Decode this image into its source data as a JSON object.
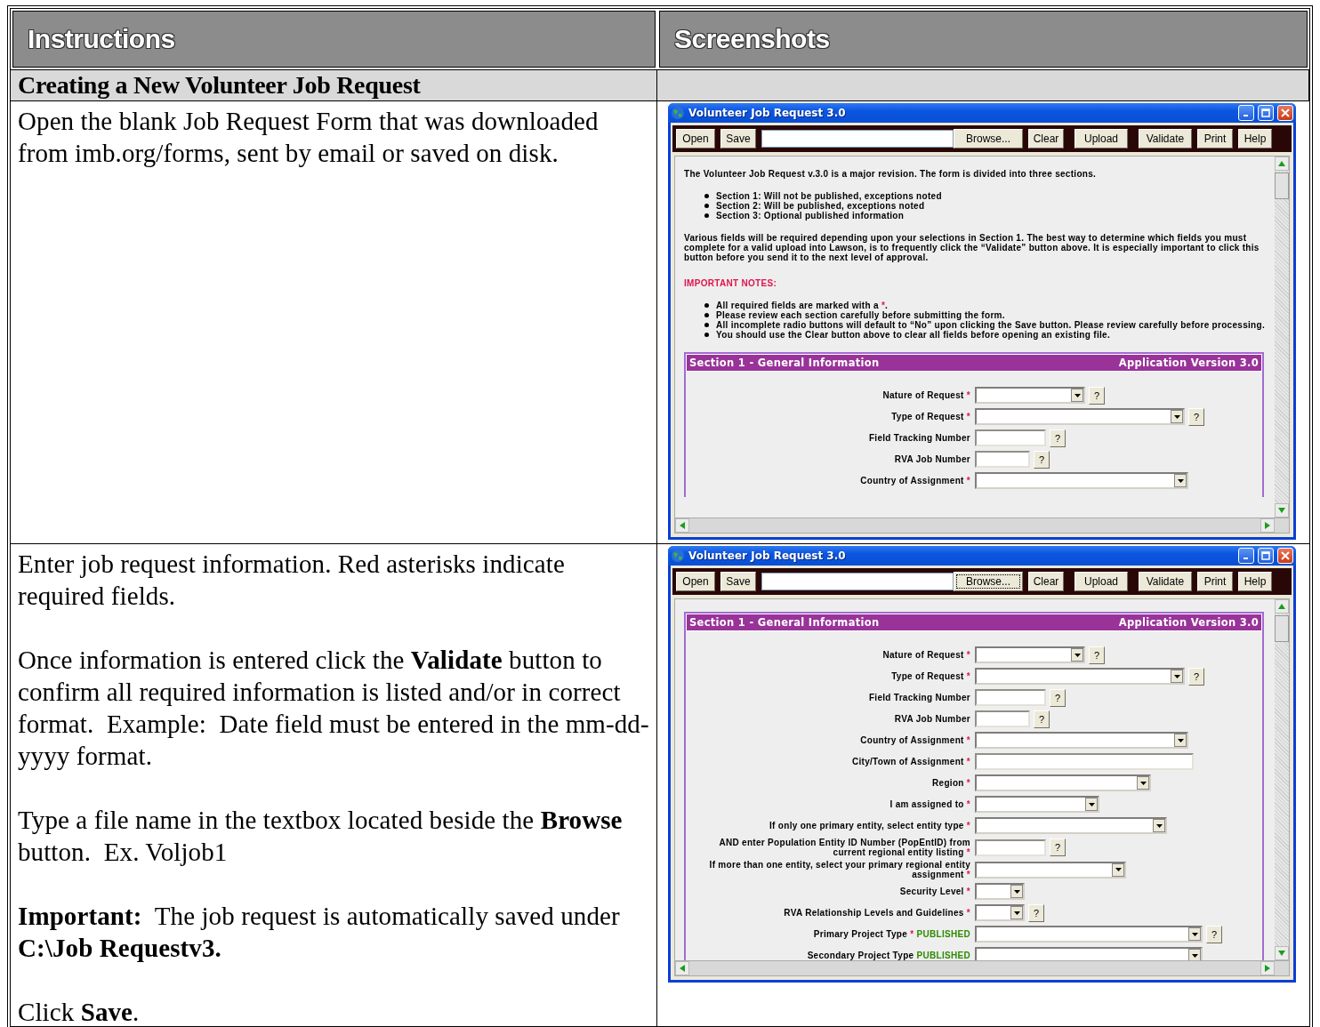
{
  "columns": [
    "Instructions",
    "Screenshots"
  ],
  "heading": "Creating a New Volunteer Job Request",
  "rows": [
    {
      "instructions": [
        "Open the blank Job Request Form that was downloaded from imb.org/forms, sent by email or saved on disk."
      ],
      "window": {
        "title": "Volunteer Job Request 3.0",
        "toolbar": [
          {
            "kind": "button",
            "label": "Open",
            "focused": false
          },
          {
            "kind": "button",
            "label": "Save",
            "focused": false
          },
          {
            "kind": "field"
          },
          {
            "kind": "button",
            "label": "Browse...",
            "focused": false
          },
          {
            "kind": "button",
            "label": "Clear",
            "focused": false
          },
          {
            "kind": "button",
            "label": "Upload",
            "focused": false
          },
          {
            "kind": "button",
            "label": "Validate",
            "focused": false
          },
          {
            "kind": "button",
            "label": "Print",
            "focused": false
          },
          {
            "kind": "button",
            "label": "Help",
            "focused": false
          }
        ],
        "intro": {
          "lead": "The Volunteer Job Request v.3.0 is a major revision. The form is divided into three sections.",
          "sections": [
            "Section 1: Will not be published, exceptions noted",
            "Section 2: Will be published, exceptions noted",
            "Section 3: Optional published information"
          ],
          "paragraph": "Various fields will be required depending upon your selections in Section 1. The best way to determine which fields you must complete for a valid upload into Lawson, is to frequently click the “Validate” button above. It is especially important to click this button before you send it to the next level of approval.",
          "notes_title": "IMPORTANT NOTES:",
          "notes": [
            {
              "text": "All required fields are marked with a ",
              "mark": "*",
              "tail": "."
            },
            {
              "text": "Please review each section carefully before submitting the form."
            },
            {
              "text": "All incomplete radio buttons will default to “No” upon clicking the Save button. Please review carefully before processing."
            },
            {
              "text": "You should use the Clear button above to clear all fields before opening an existing file."
            }
          ]
        },
        "section": {
          "title": "Section 1 - General Information",
          "version": "Application Version 3.0",
          "fields": [
            {
              "label": "Nature of Request",
              "required": "*",
              "kind": "select",
              "help": "?"
            },
            {
              "label": "Type of Request",
              "required": "*",
              "kind": "select",
              "help": "?"
            },
            {
              "label": "Field Tracking Number",
              "kind": "text",
              "help": "?"
            },
            {
              "label": "RVA Job Number",
              "kind": "text",
              "help": "?"
            },
            {
              "label": "Country of Assignment",
              "required": "*",
              "kind": "select"
            }
          ]
        }
      }
    },
    {
      "instructions": [
        "Enter job request information. Red asterisks indicate required fields.",
        "Once information is entered click the **Validate** button to confirm all required information is listed and/or in correct format.  Example:  Date field must be entered in the mm-dd-yyyy format.",
        "Type a file name in the textbox located beside the **Browse** button.  Ex. Voljob1",
        "**Important:**  The job request is automatically saved under **C:\\Job Requestv3.**",
        "Click **Save**."
      ],
      "window": {
        "title": "Volunteer Job Request 3.0",
        "toolbar": [
          {
            "kind": "button",
            "label": "Open",
            "focused": false
          },
          {
            "kind": "button",
            "label": "Save",
            "focused": false
          },
          {
            "kind": "field"
          },
          {
            "kind": "button",
            "label": "Browse...",
            "focused": true
          },
          {
            "kind": "button",
            "label": "Clear",
            "focused": false
          },
          {
            "kind": "button",
            "label": "Upload",
            "focused": false
          },
          {
            "kind": "button",
            "label": "Validate",
            "focused": false
          },
          {
            "kind": "button",
            "label": "Print",
            "focused": false
          },
          {
            "kind": "button",
            "label": "Help",
            "focused": false
          }
        ],
        "section": {
          "title": "Section 1 - General Information",
          "version": "Application Version 3.0",
          "fields": [
            {
              "label": "Nature of Request",
              "required": "*",
              "kind": "select",
              "help": "?"
            },
            {
              "label": "Type of Request",
              "required": "*",
              "kind": "select",
              "help": "?"
            },
            {
              "label": "Field Tracking Number",
              "kind": "text",
              "help": "?"
            },
            {
              "label": "RVA Job Number",
              "kind": "text",
              "help": "?"
            },
            {
              "label": "Country of Assignment",
              "required": "*",
              "kind": "select"
            },
            {
              "label": "City/Town of Assignment",
              "required": "*",
              "kind": "text"
            },
            {
              "label": "Region",
              "required": "*",
              "kind": "select"
            },
            {
              "label": "I am assigned to",
              "required": "*",
              "kind": "select"
            },
            {
              "label": "If only one primary entity, select entity type",
              "required": "*",
              "kind": "select"
            },
            {
              "label": "AND enter Population Entity ID Number (PopEntID) from current regional entity listing",
              "required": "*",
              "kind": "text",
              "help": "?"
            },
            {
              "label": "If more than one entity, select your primary regional entity assignment",
              "required": "*",
              "kind": "select"
            },
            {
              "label": "Security Level",
              "required": "*",
              "kind": "select"
            },
            {
              "label": "RVA Relationship Levels and Guidelines",
              "required": "*",
              "kind": "select",
              "help": "?"
            },
            {
              "label": "Primary Project Type",
              "required": "*",
              "published": "PUBLISHED",
              "kind": "select",
              "help": "?"
            },
            {
              "label": "Secondary Project Type",
              "published": "PUBLISHED",
              "kind": "select"
            }
          ]
        }
      }
    }
  ]
}
